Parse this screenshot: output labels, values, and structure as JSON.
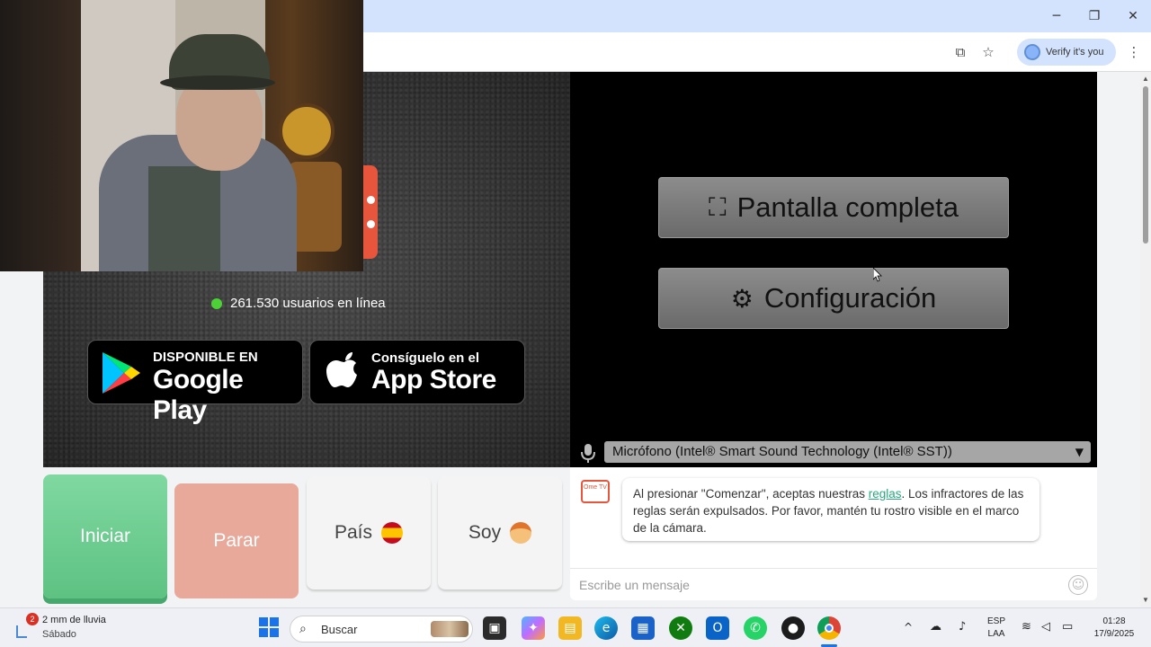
{
  "browser": {
    "verify_label": "Verify it's you",
    "minimize": "─",
    "restore": "❐",
    "close": "✕"
  },
  "stage": {
    "online_count": "261.530 usuarios en línea",
    "google_play": {
      "small": "DISPONIBLE EN",
      "big": "Google Play"
    },
    "app_store": {
      "small": "Consíguelo en el",
      "big": "App Store"
    }
  },
  "controls": {
    "fullscreen": "Pantalla completa",
    "settings": "Configuración",
    "microphone": "Micrófono (Intel® Smart Sound Technology (Intel® SST))"
  },
  "actions": {
    "start": "Iniciar",
    "stop": "Parar",
    "country": "País",
    "gender": "Soy"
  },
  "chat": {
    "logo": "Ome TV",
    "rules_pre": "Al presionar \"Comenzar\", aceptas nuestras ",
    "rules_link": "reglas",
    "rules_post": ". Los infractores de las reglas serán expulsados. Por favor, mantén tu rostro visible en el marco de la cámara.",
    "placeholder": "Escribe un mensaje"
  },
  "taskbar": {
    "weather_badge": "2",
    "weather_temp": "2 mm de lluvia",
    "weather_day": "Sábado",
    "search_placeholder": "Buscar",
    "lang_top": "ESP",
    "lang_bottom": "LAA",
    "time": "01:28",
    "date": "17/9/2025"
  },
  "colors": {
    "start": "#5ec283",
    "stop": "#e8a99b",
    "brand": "#e8553d",
    "online_dot": "#4cd137"
  }
}
